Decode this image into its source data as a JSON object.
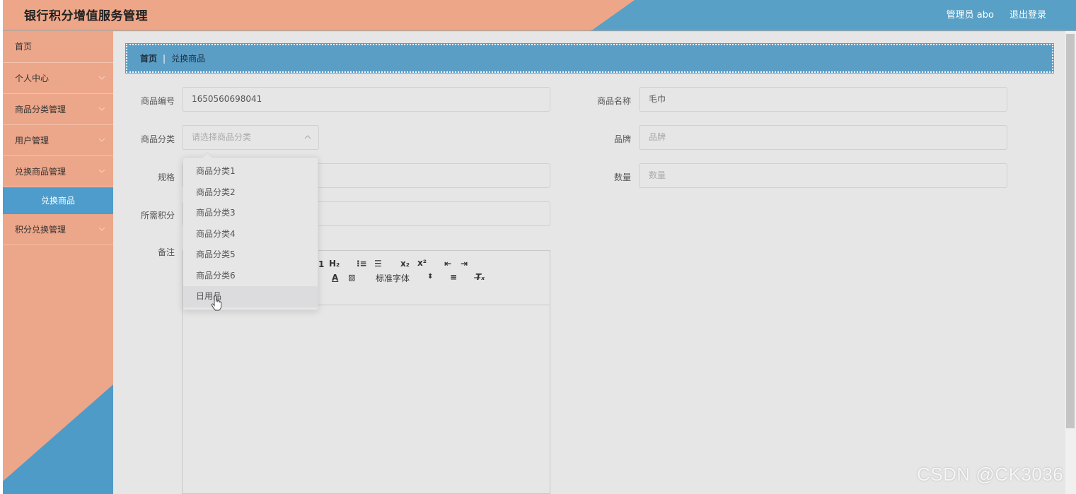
{
  "header": {
    "title": "银行积分增值服务管理",
    "user": "管理员 abo",
    "logout": "退出登录",
    "colors": {
      "salmon": "#eea688",
      "blue": "#58a0c6"
    }
  },
  "sidebar": {
    "items": [
      {
        "label": "首页"
      },
      {
        "label": "个人中心"
      },
      {
        "label": "商品分类管理"
      },
      {
        "label": "用户管理"
      },
      {
        "label": "兑换商品管理"
      },
      {
        "label": "兑换商品"
      },
      {
        "label": "积分兑换管理"
      }
    ]
  },
  "breadcrumb": {
    "home": "首页",
    "separator": "|",
    "current": "兑换商品"
  },
  "form": {
    "code_label": "商品编号",
    "code_value": "1650560698041",
    "name_label": "商品名称",
    "name_value": "毛巾",
    "category_label": "商品分类",
    "category_placeholder": "请选择商品分类",
    "brand_label": "品牌",
    "brand_placeholder": "品牌",
    "spec_label": "规格",
    "quantity_label": "数量",
    "quantity_placeholder": "数量",
    "points_label": "所需积分",
    "remark_label": "备注"
  },
  "editor": {
    "toolbar_row1": [
      "1",
      "H₂",
      "⁝≡",
      "☰",
      "x₂",
      "x²",
      "⇤",
      "⇥"
    ],
    "font_select": "标准字体",
    "font_select_arrow": "⬍",
    "toolbar_row2": [
      "A",
      "▧",
      "≡",
      "T̶ₓ"
    ]
  },
  "dropdown": {
    "options": [
      "商品分类1",
      "商品分类2",
      "商品分类3",
      "商品分类4",
      "商品分类5",
      "商品分类6",
      "日用品"
    ],
    "hovered_index": 6
  },
  "watermark": "CSDN @CK3036"
}
